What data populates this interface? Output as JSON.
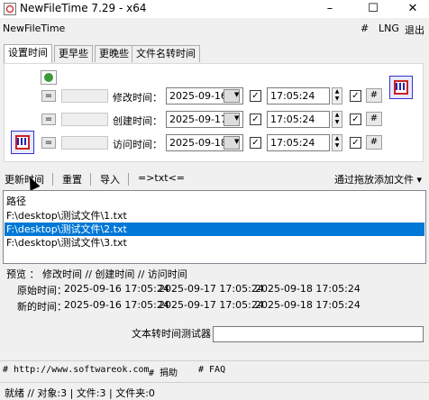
{
  "window": {
    "title": "NewFileTime 7.29 - x64",
    "minimize_glyph": "–",
    "maximize_glyph": "☐",
    "close_glyph": "✕"
  },
  "menubar": {
    "app_label": "NewFileTime",
    "hash": "#",
    "lng": "LNG",
    "exit": "退出"
  },
  "tabs": [
    {
      "label": "设置时间",
      "active": true
    },
    {
      "label": "更早些",
      "active": false
    },
    {
      "label": "更晚些",
      "active": false
    },
    {
      "label": "文件名转时间",
      "active": false
    }
  ],
  "rows": [
    {
      "eq": "=",
      "label": "修改时间：",
      "date": "2025-09-16",
      "checked_date": true,
      "time": "17:05:24",
      "checked_time": true,
      "hash": "#"
    },
    {
      "eq": "=",
      "label": "创建时间：",
      "date": "2025-09-17",
      "checked_date": true,
      "time": "17:05:24",
      "checked_time": true,
      "hash": "#"
    },
    {
      "eq": "=",
      "label": "访问时间：",
      "date": "2025-09-18",
      "checked_date": true,
      "time": "17:05:24",
      "checked_time": true,
      "hash": "#"
    }
  ],
  "toolbar": {
    "update": "更新时间",
    "reset": "重置",
    "import": "导入",
    "txt": "=>txt<=",
    "drag_add": "通过拖放添加文件 ▾"
  },
  "list": {
    "header": "路径",
    "items": [
      {
        "path": "F:\\desktop\\测试文件\\1.txt",
        "selected": false
      },
      {
        "path": "F:\\desktop\\测试文件\\2.txt",
        "selected": true
      },
      {
        "path": "F:\\desktop\\测试文件\\3.txt",
        "selected": false
      }
    ]
  },
  "preview": {
    "header": "预览 ：  修改时间   //   创建时间   //   访问时间",
    "original_label": "原始时间：",
    "new_label": "新的时间：",
    "original": [
      "2025-09-16 17:05:24",
      "2025-09-17 17:05:24",
      "2025-09-18 17:05:24"
    ],
    "new": [
      "2025-09-16 17:05:24",
      "2025-09-17 17:05:24",
      "2025-09-18 17:05:24"
    ]
  },
  "tester": {
    "label": "文本转时间测试器",
    "value": ""
  },
  "links": {
    "site": "# http://www.softwareok.com",
    "donate": "# 捐助",
    "faq": "# FAQ"
  },
  "status": {
    "text": "就绪 // 对象:3 | 文件:3 | 文件夹:0"
  },
  "colors": {
    "selection": "#0078d7",
    "window_bg": "#f0f0f0"
  }
}
